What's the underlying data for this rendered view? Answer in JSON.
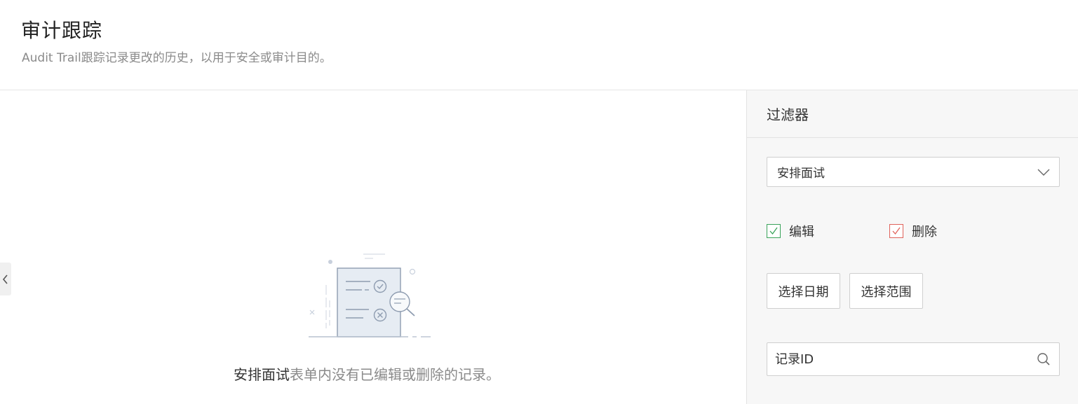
{
  "header": {
    "title": "审计跟踪",
    "subtitle": "Audit Trail跟踪记录更改的历史，以用于安全或审计目的。"
  },
  "main": {
    "empty_module": "安排面试",
    "empty_message": "表单内没有已编辑或删除的记录。",
    "collapse_icon": "chevron-left-icon",
    "illustration_icon": "document-search-icon"
  },
  "filter": {
    "title": "过滤器",
    "module_select": {
      "value": "安排面试",
      "icon": "chevron-down-icon"
    },
    "checkboxes": [
      {
        "label": "编辑",
        "checked": true,
        "color": "#3aa35a"
      },
      {
        "label": "删除",
        "checked": true,
        "color": "#e0625a"
      }
    ],
    "buttons": {
      "select_date": "选择日期",
      "select_range": "选择范围"
    },
    "record_search": {
      "placeholder": "记录ID",
      "icon": "search-icon"
    }
  }
}
